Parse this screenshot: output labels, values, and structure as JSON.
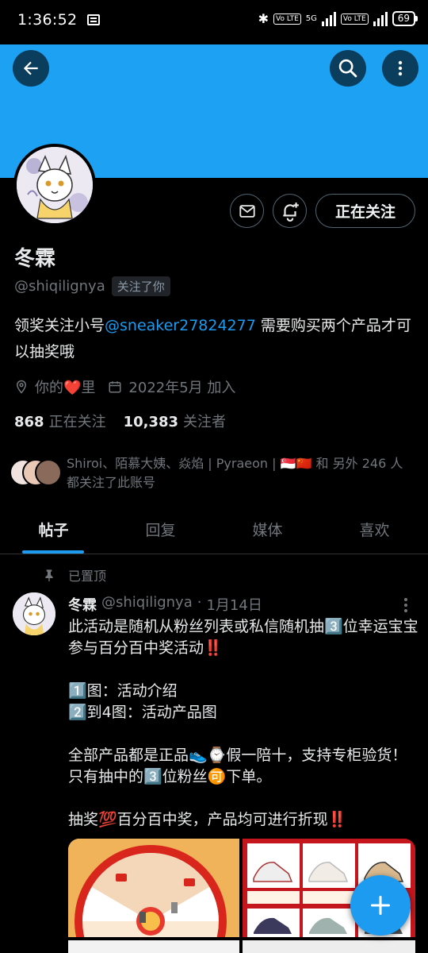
{
  "status_bar": {
    "time": "1:36:52",
    "network": "5G",
    "volte_1": "Vo LTE",
    "volte_2": "Vo LTE",
    "battery": "69"
  },
  "header": {
    "banner_color": "#1da1f2",
    "back_icon": "arrow-left-icon",
    "search_icon": "search-icon",
    "more_icon": "more-vertical-icon"
  },
  "profile": {
    "name": "冬霖",
    "handle": "@shiqilignya",
    "follows_you": "关注了你",
    "bio_prefix": "领奖关注小号",
    "bio_mention": "@sneaker27824277",
    "bio_suffix": " 需要购买两个产品才可以抽奖哦",
    "location": "你的❤️里",
    "joined": "2022年5月 加入",
    "following_count": "868",
    "following_label": "正在关注",
    "followers_count": "10,383",
    "followers_label": "关注者",
    "followed_by_text": "Shiroi、陌慕大姨、焱焰 | Pyraeon | 🇸🇬🇨🇳 和 另外 246 人 都关注了此账号",
    "follow_button_label": "正在关注"
  },
  "tabs": [
    {
      "label": "帖子",
      "active": true
    },
    {
      "label": "回复",
      "active": false
    },
    {
      "label": "媒体",
      "active": false
    },
    {
      "label": "喜欢",
      "active": false
    }
  ],
  "post": {
    "pinned_label": "已置顶",
    "author_name": "冬霖",
    "author_handle": "@shiqilignya",
    "separator": "·",
    "date": "1月14日",
    "lines": [
      "此活动是随机从粉丝列表或私信随机抽3️⃣位幸运宝宝参与百分百中奖活动‼️",
      "",
      "1️⃣图：活动介绍",
      "2️⃣到4图：活动产品图",
      "",
      "全部产品都是正品👟⌚假一陪十，支持专柜验货！只有抽中的3️⃣位粉丝🉑下单。",
      "",
      "抽奖💯百分百中奖，产品均可进行折现‼️"
    ]
  },
  "colors": {
    "accent": "#1d9bf0",
    "background": "#000000",
    "text_primary": "#e7e9ea",
    "text_secondary": "#71767b"
  }
}
